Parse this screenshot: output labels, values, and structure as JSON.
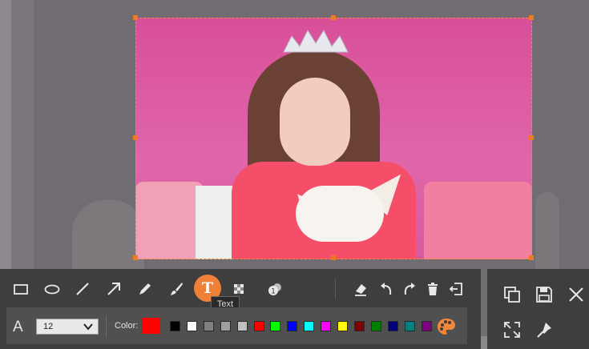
{
  "tooltip": "Text",
  "text_options": {
    "font_size_value": "12",
    "color_label": "Color:",
    "current_color": "#ff0000",
    "palette": [
      "#000000",
      "#ffffff",
      "#808080",
      "#a0a0a0",
      "#c0c0c0",
      "#ff0000",
      "#00ff00",
      "#0000ff",
      "#00ffff",
      "#ff00ff",
      "#ffff00",
      "#800000",
      "#008000",
      "#000080",
      "#008080",
      "#800080"
    ]
  },
  "tools": [
    {
      "name": "rectangle-tool",
      "icon": "rectangle-icon"
    },
    {
      "name": "ellipse-tool",
      "icon": "ellipse-icon"
    },
    {
      "name": "line-tool",
      "icon": "line-icon"
    },
    {
      "name": "arrow-tool",
      "icon": "arrow-icon"
    },
    {
      "name": "pencil-tool",
      "icon": "pencil-icon"
    },
    {
      "name": "brush-tool",
      "icon": "brush-icon"
    },
    {
      "name": "text-tool",
      "icon": "text-icon",
      "active": true
    },
    {
      "name": "mosaic-tool",
      "icon": "mosaic-icon"
    },
    {
      "name": "step-tool",
      "icon": "step-number-icon"
    },
    {
      "name": "eraser-tool",
      "icon": "eraser-icon"
    },
    {
      "name": "undo",
      "icon": "undo-icon"
    },
    {
      "name": "redo",
      "icon": "redo-icon"
    },
    {
      "name": "delete",
      "icon": "trash-icon"
    },
    {
      "name": "exit",
      "icon": "exit-icon"
    }
  ],
  "side_actions": [
    {
      "name": "copy",
      "icon": "copy-icon"
    },
    {
      "name": "save",
      "icon": "save-icon"
    },
    {
      "name": "close",
      "icon": "close-icon"
    },
    {
      "name": "fullscreen",
      "icon": "expand-icon"
    },
    {
      "name": "pin",
      "icon": "pin-icon"
    }
  ],
  "accent_color": "#ee8137"
}
